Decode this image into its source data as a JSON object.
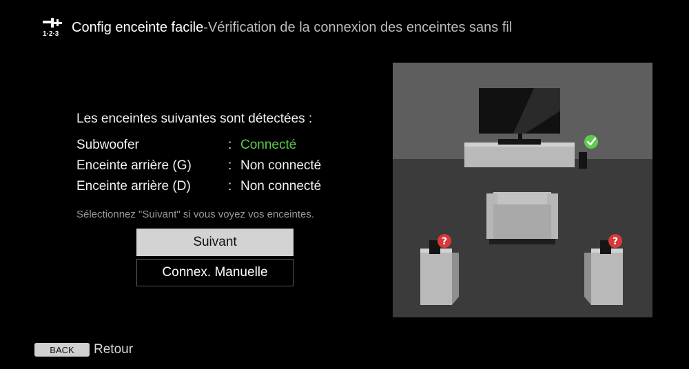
{
  "header": {
    "icon": "tools-123-icon",
    "icon_caption": "1·2·3",
    "title": "Config enceinte facile",
    "subtitle": "-Vérification de la connexion des enceintes sans fil"
  },
  "main": {
    "detected_text": "Les enceintes suivantes sont détectées :",
    "speakers": [
      {
        "label": "Subwoofer",
        "colon": ":",
        "status": "Connecté"
      },
      {
        "label": "Enceinte arrière (G)",
        "colon": ":",
        "status": "Non connecté"
      },
      {
        "label": "Enceinte arrière (D)",
        "colon": ":",
        "status": "Non connecté"
      }
    ],
    "hint": "Sélectionnez \"Suivant\" si vous voyez vos enceintes.",
    "next_label": "Suivant",
    "manual_label": "Connex. Manuelle"
  },
  "footer": {
    "back_key": "BACK",
    "back_label": "Retour"
  },
  "colors": {
    "connected": "#5ecb4f",
    "unknown_badge": "#d9383a",
    "button_focus_bg": "#d3d3d3",
    "background": "#000000"
  }
}
